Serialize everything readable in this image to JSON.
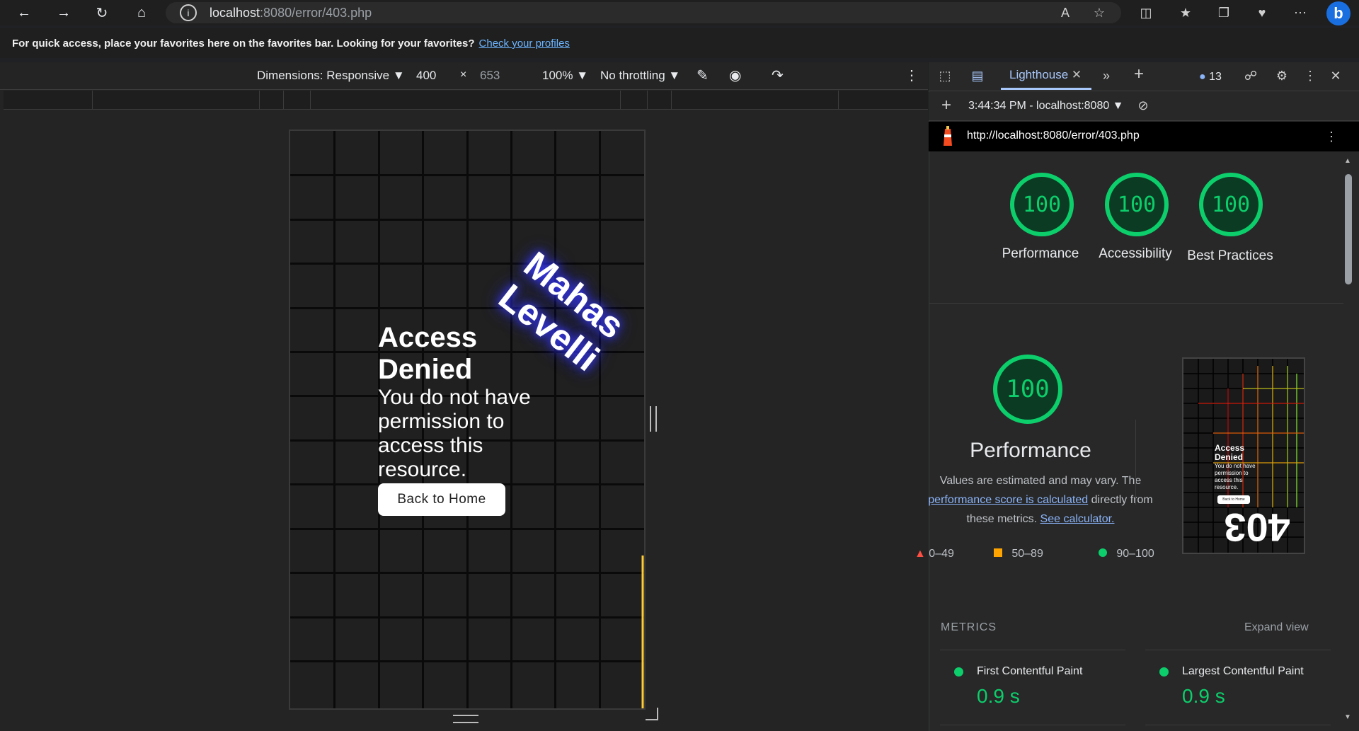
{
  "browser": {
    "url_host": "localhost",
    "url_rest": ":8080/error/403.php",
    "favbar_text": "For quick access, place your favorites here on the favorites bar. Looking for your favorites?",
    "favbar_link": "Check your profiles"
  },
  "emulation": {
    "dimensions_label": "Dimensions: Responsive",
    "width": "400",
    "times": "×",
    "height": "653",
    "zoom": "100%",
    "throttling": "No throttling"
  },
  "page": {
    "title_line1": "Access",
    "title_line2": "Denied",
    "message": "You do not have permission to access this resource.",
    "back_button": "Back to Home",
    "rotated_line1": "Mahas",
    "rotated_line2": "Levelli"
  },
  "devtools": {
    "tab_label": "Lighthouse",
    "issues_count": "13",
    "report_time": "3:44:34 PM - localhost:8080",
    "report_url": "http://localhost:8080/error/403.php",
    "scores": [
      {
        "value": "100",
        "label": "Performance"
      },
      {
        "value": "100",
        "label": "Accessibility"
      },
      {
        "value": "100",
        "label": "Best Practices"
      }
    ],
    "perf_score": "100",
    "perf_title": "Performance",
    "perf_desc_1": "Values are estimated and may vary. The",
    "perf_desc_link1": "performance score is calculated",
    "perf_desc_2": "directly from these metrics.",
    "perf_desc_link2": "See calculator.",
    "legend": [
      "0–49",
      "50–89",
      "90–100"
    ],
    "thumb_title": "Access Denied",
    "thumb_msg": "You do not have permission to access this resource.",
    "thumb_btn": "Back to Home",
    "thumb_big": "403",
    "metrics_label": "METRICS",
    "expand_label": "Expand view",
    "metrics": [
      {
        "name": "First Contentful Paint",
        "value": "0.9 s"
      },
      {
        "name": "Largest Contentful Paint",
        "value": "0.9 s"
      }
    ],
    "colors": {
      "pass": "#0cce6b",
      "average": "#ffa400",
      "fail": "#ff4e42"
    }
  }
}
